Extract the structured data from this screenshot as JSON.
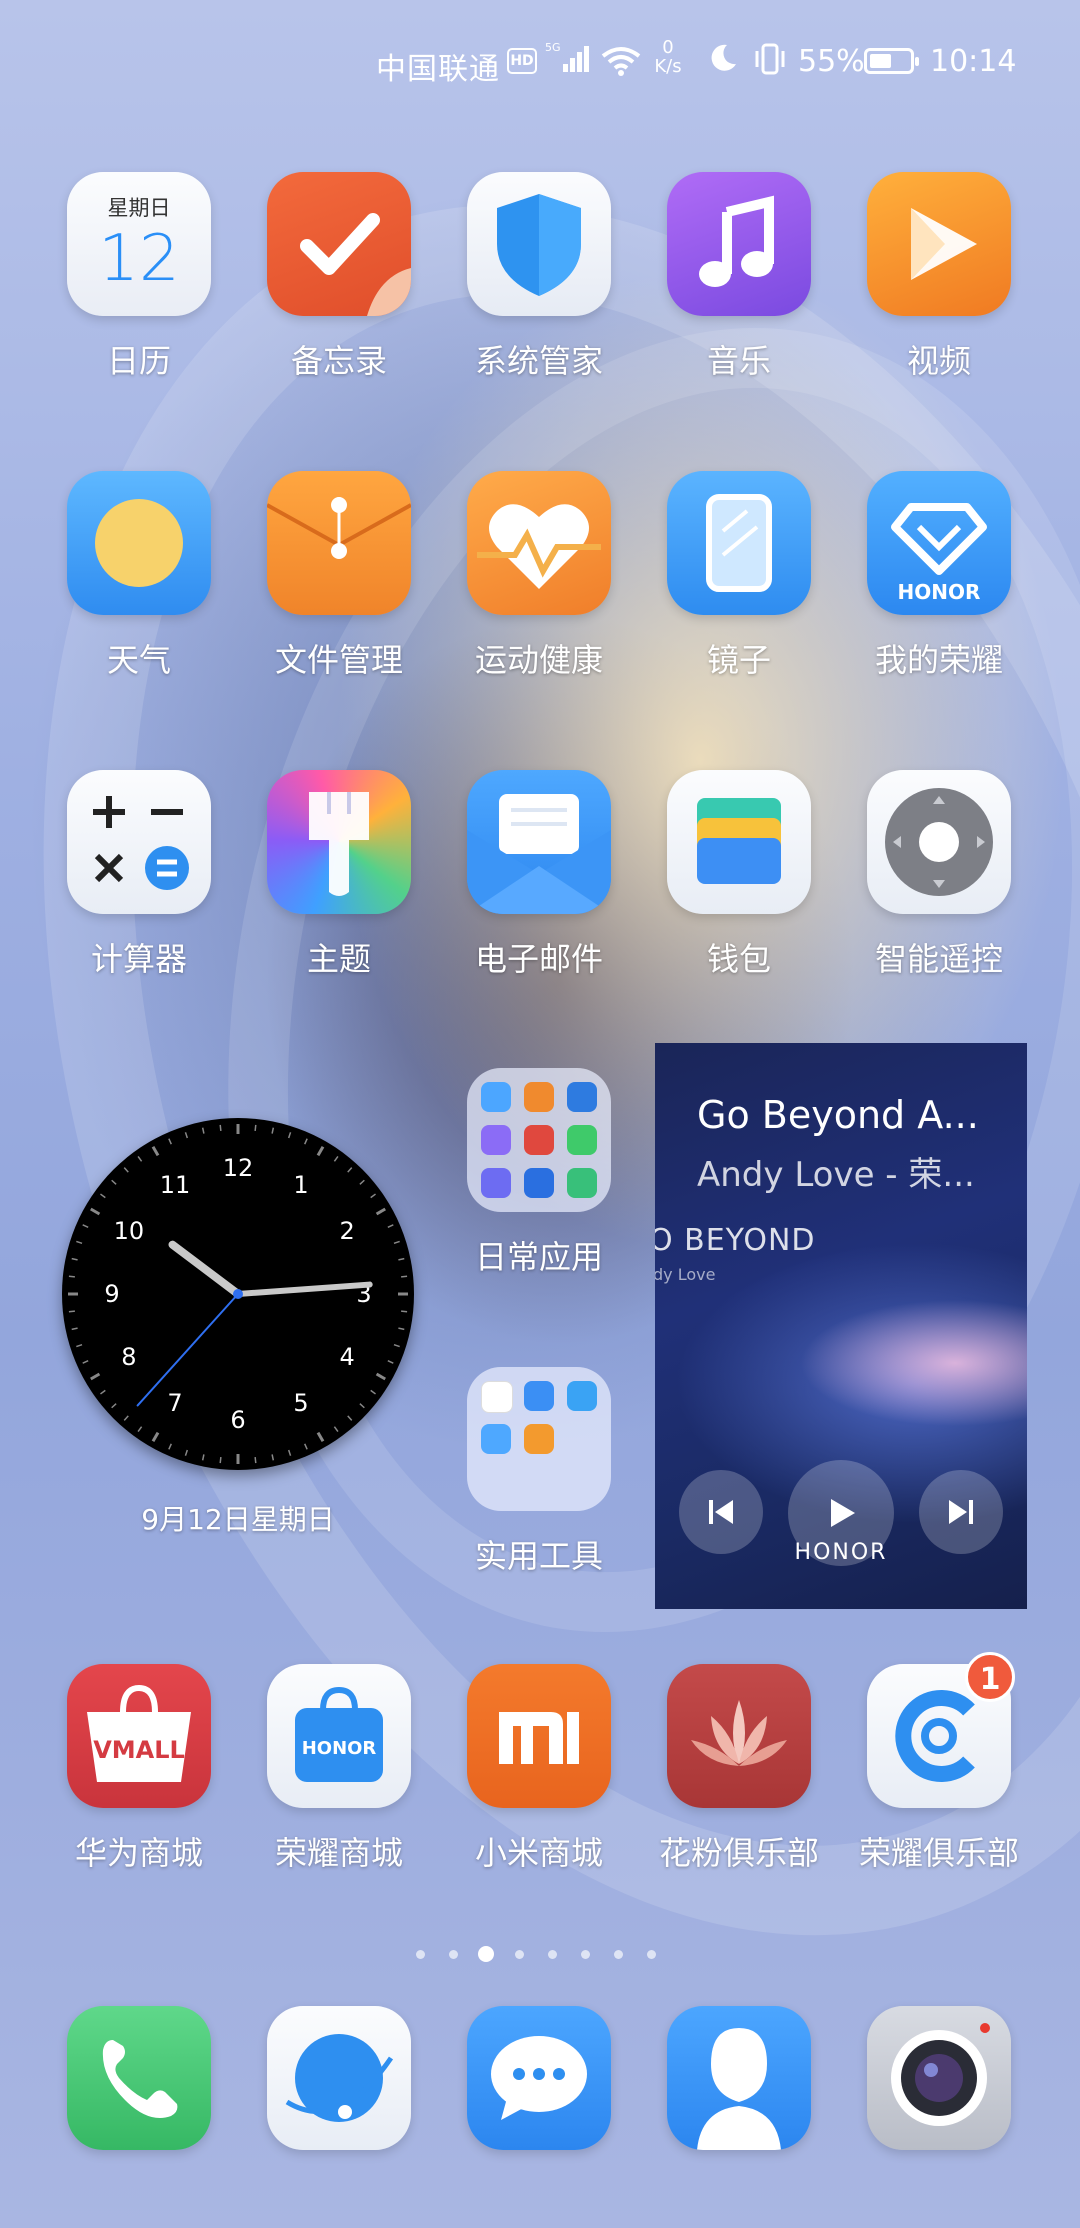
{
  "status_bar": {
    "carrier": "中国联通",
    "hd_label": "HD",
    "net_type": "5G",
    "speed_value": "0",
    "speed_unit": "K/s",
    "battery_percent": "55%",
    "battery_level": 0.55,
    "time": "10:14"
  },
  "apps": {
    "calendar": {
      "label": "日历",
      "weekday": "星期日",
      "day": "12"
    },
    "memo": {
      "label": "备忘录"
    },
    "system_manager": {
      "label": "系统管家"
    },
    "music": {
      "label": "音乐"
    },
    "video": {
      "label": "视频"
    },
    "weather": {
      "label": "天气"
    },
    "files": {
      "label": "文件管理"
    },
    "health": {
      "label": "运动健康"
    },
    "mirror": {
      "label": "镜子"
    },
    "my_honor": {
      "label": "我的荣耀",
      "brand": "HONOR"
    },
    "calculator": {
      "label": "计算器"
    },
    "themes": {
      "label": "主题"
    },
    "email": {
      "label": "电子邮件"
    },
    "wallet": {
      "label": "钱包"
    },
    "remote": {
      "label": "智能遥控"
    },
    "vmall": {
      "label": "华为商城",
      "brand": "VMALL"
    },
    "honor_store": {
      "label": "荣耀商城",
      "brand": "HONOR"
    },
    "mi_store": {
      "label": "小米商城"
    },
    "huafen": {
      "label": "花粉俱乐部"
    },
    "honor_club": {
      "label": "荣耀俱乐部",
      "badge": "1"
    }
  },
  "clock_widget": {
    "numbers": [
      "12",
      "1",
      "2",
      "3",
      "4",
      "5",
      "6",
      "7",
      "8",
      "9",
      "10",
      "11"
    ],
    "date": "9月12日星期日"
  },
  "folders": {
    "daily": {
      "label": "日常应用"
    },
    "tools": {
      "label": "实用工具"
    }
  },
  "music_widget": {
    "title": "Go Beyond A...",
    "artist": "Andy Love - 荣...",
    "cover_title": "O BEYOND",
    "cover_subtitle": "dy Love",
    "brand": "HONOR"
  },
  "page_indicator": {
    "pages": 8,
    "current": 3
  },
  "dock": [
    "phone",
    "browser",
    "messages",
    "contacts",
    "camera"
  ]
}
